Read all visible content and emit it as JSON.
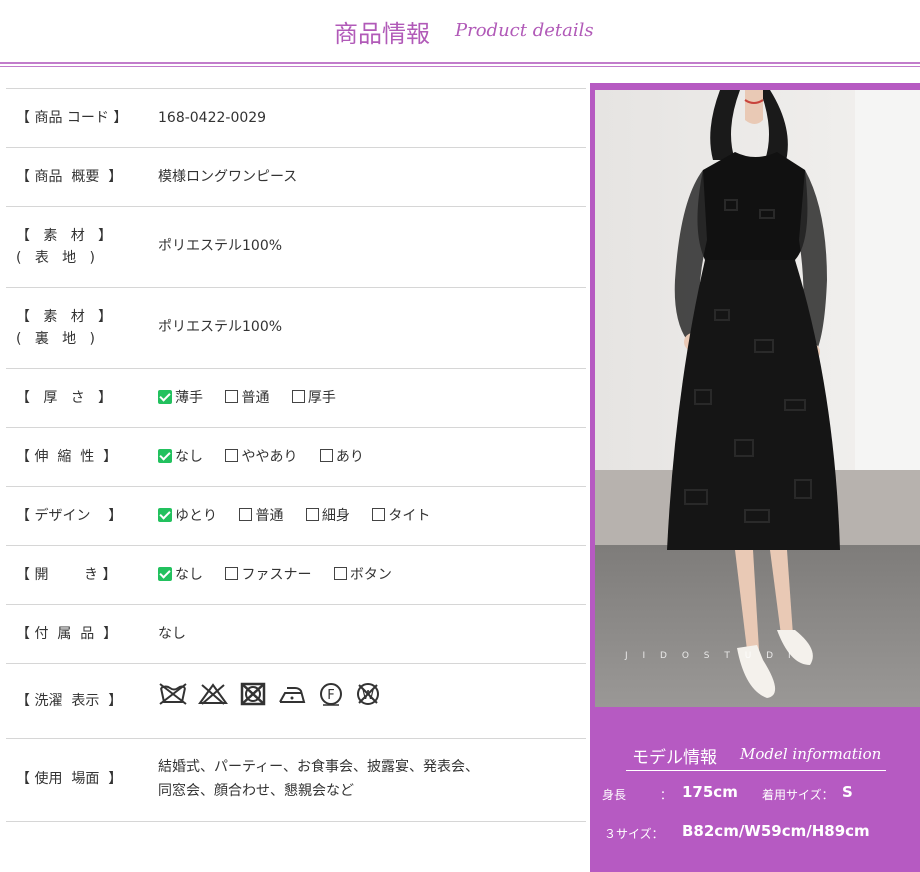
{
  "header": {
    "title_jp": "商品情報",
    "title_en": "Product details"
  },
  "details": {
    "code": {
      "label": "【 商品 コード 】",
      "value": "168-0422-0029"
    },
    "summary": {
      "label": "【 商品  概要  】",
      "value": "模様ロングワンピース"
    },
    "material_outer": {
      "label1": "【   素   材   】",
      "label2": "(   表   地   )",
      "value": "ポリエステル100%"
    },
    "material_lining": {
      "label1": "【   素   材   】",
      "label2": "(   裏   地   )",
      "value": "ポリエステル100%"
    },
    "thickness": {
      "label": "【   厚   さ   】",
      "options": [
        "薄手",
        "普通",
        "厚手"
      ],
      "checked": 0
    },
    "stretch": {
      "label": "【 伸  縮  性  】",
      "options": [
        "なし",
        "ややあり",
        "あり"
      ],
      "checked": 0
    },
    "design": {
      "label": "【 デザイン    】",
      "options": [
        "ゆとり",
        "普通",
        "細身",
        "タイト"
      ],
      "checked": 0
    },
    "opening": {
      "label": "【 開        き 】",
      "options": [
        "なし",
        "ファスナー",
        "ボタン"
      ],
      "checked": 0
    },
    "accessories": {
      "label": "【 付  属  品  】",
      "value": "なし"
    },
    "washing": {
      "label": "【 洗濯  表示  】",
      "icons": [
        "no-hand-wash-icon",
        "no-bleach-icon",
        "no-tumble-dry-icon",
        "low-iron-icon",
        "dry-clean-f-icon",
        "no-wring-icon"
      ]
    },
    "occasion": {
      "label": "【 使用  場面  】",
      "line1": "結婚式、パーティー、お食事会、披露宴、発表会、",
      "line2": "同窓会、顔合わせ、懇親会など"
    }
  },
  "model": {
    "title_jp": "モデル情報",
    "title_en": "Model information",
    "height_label": "身長",
    "height_sep": "：",
    "height_value": "175cm",
    "size_label": "着用サイズ：",
    "size_value": "S",
    "three_size_label": "３サイズ：",
    "three_size_value": "B82cm/W59cm/H89cm",
    "photo_watermark": "J I D O S T U D I"
  },
  "colors": {
    "accent": "#b65ac2",
    "check": "#22c15e",
    "divider": "#d6d6d6"
  }
}
